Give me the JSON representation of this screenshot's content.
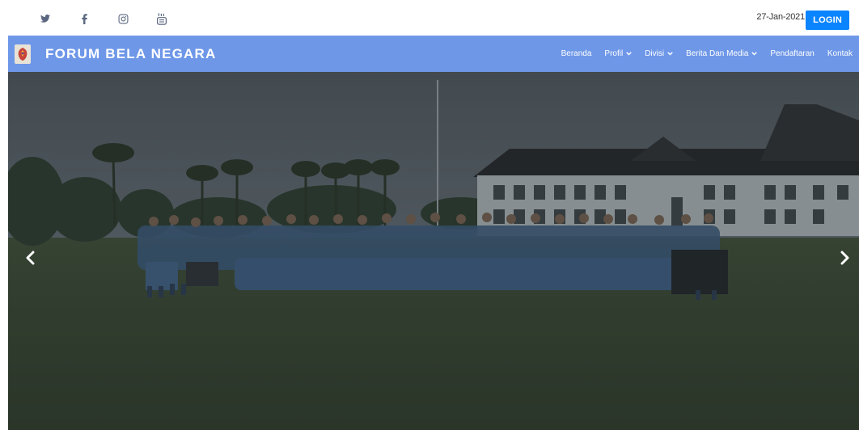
{
  "topbar": {
    "social_icons": [
      "twitter-icon",
      "facebook-icon",
      "instagram-icon",
      "youtube-icon"
    ],
    "date": "27-Jan-2021",
    "login_label": "LOGIN"
  },
  "navbar": {
    "brand_name": "FORUM BELA NEGARA",
    "items": [
      {
        "label": "Beranda",
        "dropdown": false
      },
      {
        "label": "Profil",
        "dropdown": true
      },
      {
        "label": "Divisi",
        "dropdown": true
      },
      {
        "label": "Berita Dan Media",
        "dropdown": true
      },
      {
        "label": "Pendaftaran",
        "dropdown": false
      },
      {
        "label": "Kontak",
        "dropdown": false
      }
    ]
  },
  "hero": {
    "prev_icon": "chevron-left-icon",
    "next_icon": "chevron-right-icon"
  },
  "colors": {
    "navbar_bg": "#6e97e8",
    "login_bg": "#0a84ff",
    "social_icon": "#5b6780"
  }
}
